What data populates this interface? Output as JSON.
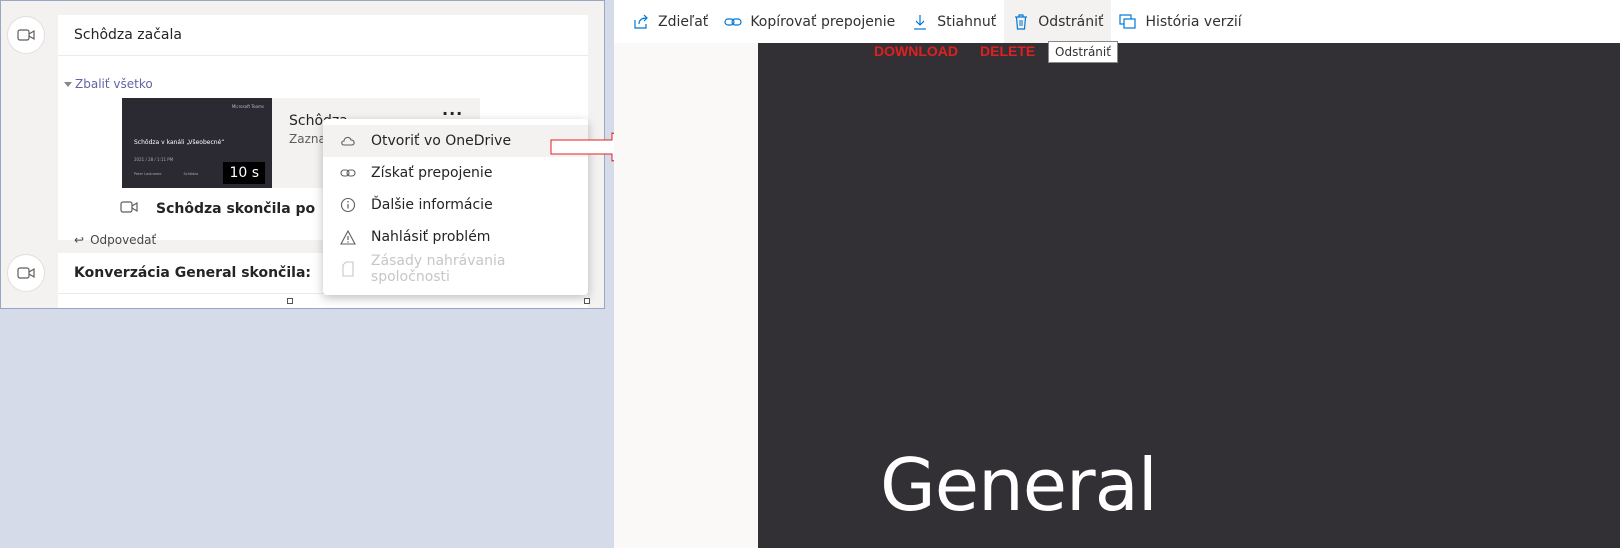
{
  "teams": {
    "meeting_started": "Schôdza začala",
    "collapse_all": "Zbaliť všetko",
    "recording": {
      "title": "Schôdza",
      "subtitle": "Zaznam",
      "duration": "10 s",
      "thumb_brand": "Microsoft Teams",
      "thumb_title": "Schôdza v kanáli „Všeobecné“",
      "thumb_meta": "2021 / 28 / 1:11 PM",
      "thumb_foot_left": "Peter Lastname",
      "thumb_foot_right": "Schôdza"
    },
    "meeting_ended": "Schôdza skončila po",
    "reply": "Odpovedať",
    "conversation_ended": "Konverzácia General skončila:"
  },
  "context_menu": {
    "items": [
      {
        "label": "Otvoriť vo OneDrive",
        "icon": "cloud-icon",
        "state": "hover"
      },
      {
        "label": "Získať prepojenie",
        "icon": "link-icon",
        "state": "normal"
      },
      {
        "label": "Ďalšie informácie",
        "icon": "info-icon",
        "state": "normal"
      },
      {
        "label": "Nahlásiť problém",
        "icon": "warning-icon",
        "state": "normal"
      },
      {
        "label": "Zásady nahrávania spoločnosti",
        "icon": "document-icon",
        "state": "disabled"
      }
    ]
  },
  "onedrive": {
    "commands": [
      {
        "label": "Zdieľať",
        "icon": "share-icon"
      },
      {
        "label": "Kopírovať prepojenie",
        "icon": "link-icon"
      },
      {
        "label": "Stiahnuť",
        "icon": "download-icon"
      },
      {
        "label": "Odstrániť",
        "icon": "trash-icon"
      },
      {
        "label": "História verzií",
        "icon": "history-icon"
      }
    ],
    "annotation_download": "DOWNLOAD",
    "annotation_delete": "DELETE",
    "tooltip": "Odstrániť",
    "viewer_text": "General"
  },
  "colors": {
    "accent": "#6264a7",
    "onedrive_blue": "#0078d4",
    "annotation_red": "#e02020",
    "viewer_bg": "#323035"
  }
}
